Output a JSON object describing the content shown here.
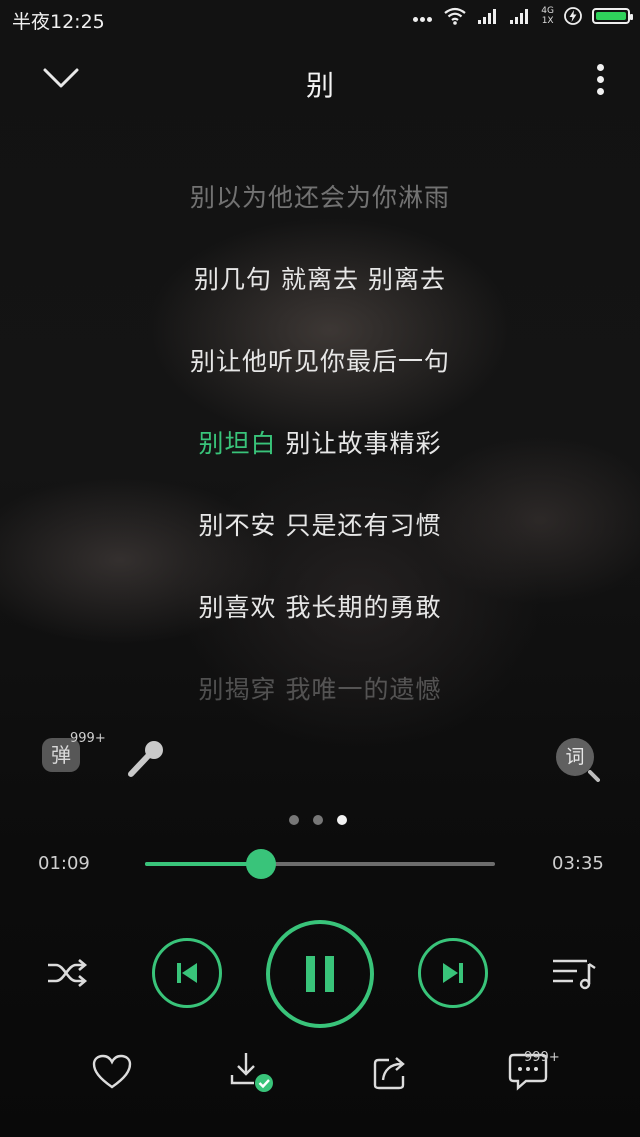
{
  "status_bar": {
    "time": "半夜12:25",
    "network_top": "4G",
    "network_bottom": "1X"
  },
  "header": {
    "title": "别"
  },
  "lyrics": [
    {
      "text": "别以为他还会为你淋雨",
      "state": "past"
    },
    {
      "text": "别几句 就离去 别离去",
      "state": "normal"
    },
    {
      "text": "别让他听见你最后一句",
      "state": "normal"
    },
    {
      "text_highlight": "别坦白",
      "text_rest": " 别让故事精彩",
      "state": "current"
    },
    {
      "text": "别不安 只是还有习惯",
      "state": "normal"
    },
    {
      "text": "别喜欢 我长期的勇敢",
      "state": "normal"
    },
    {
      "text": "别揭穿 我唯一的遗憾",
      "state": "fading"
    }
  ],
  "tools": {
    "danmu_label": "弹",
    "danmu_count": "999+",
    "lyrics_button_label": "词"
  },
  "pager": {
    "count": 3,
    "active_index": 2
  },
  "progress": {
    "current": "01:09",
    "total": "03:35",
    "fraction": 0.33
  },
  "bottom_bar": {
    "comment_count": "999+"
  },
  "colors": {
    "accent": "#39c47a",
    "battery": "#2fd15b",
    "background": "#0b0b0b"
  },
  "icons": [
    "chevron-down-icon",
    "more-vertical-icon",
    "microphone-icon",
    "shuffle-icon",
    "previous-icon",
    "pause-icon",
    "next-icon",
    "playlist-icon",
    "heart-icon",
    "download-icon",
    "share-icon",
    "comment-icon"
  ]
}
